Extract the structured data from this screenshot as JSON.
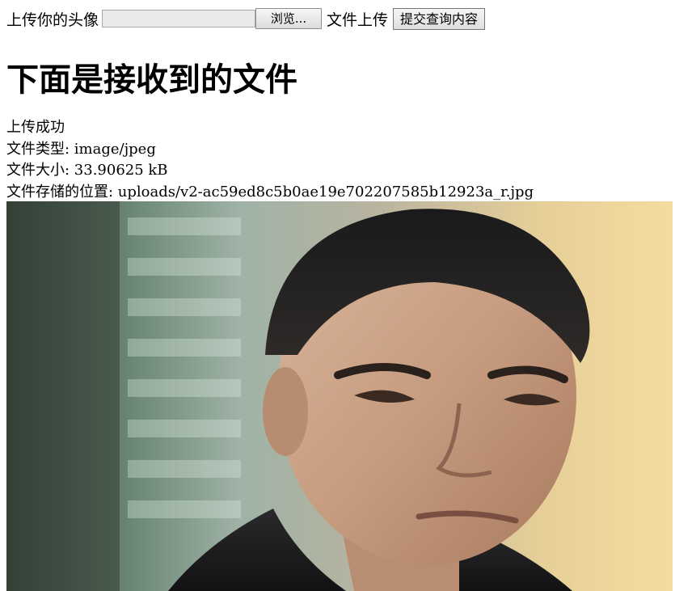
{
  "form": {
    "avatar_label": "上传你的头像",
    "browse_label": "浏览...",
    "file_upload_label": "文件上传",
    "submit_label": "提交查询内容"
  },
  "heading": "下面是接收到的文件",
  "result": {
    "status": "上传成功",
    "type_line": "文件类型: image/jpeg",
    "size_line": "文件大小: 33.90625 kB",
    "path_line": "文件存储的位置: uploads/v2-ac59ed8c5b0ae19e702207585b12923a_r.jpg"
  },
  "colors": {
    "button_border": "#767676",
    "field_bg": "#e9e9e9"
  }
}
